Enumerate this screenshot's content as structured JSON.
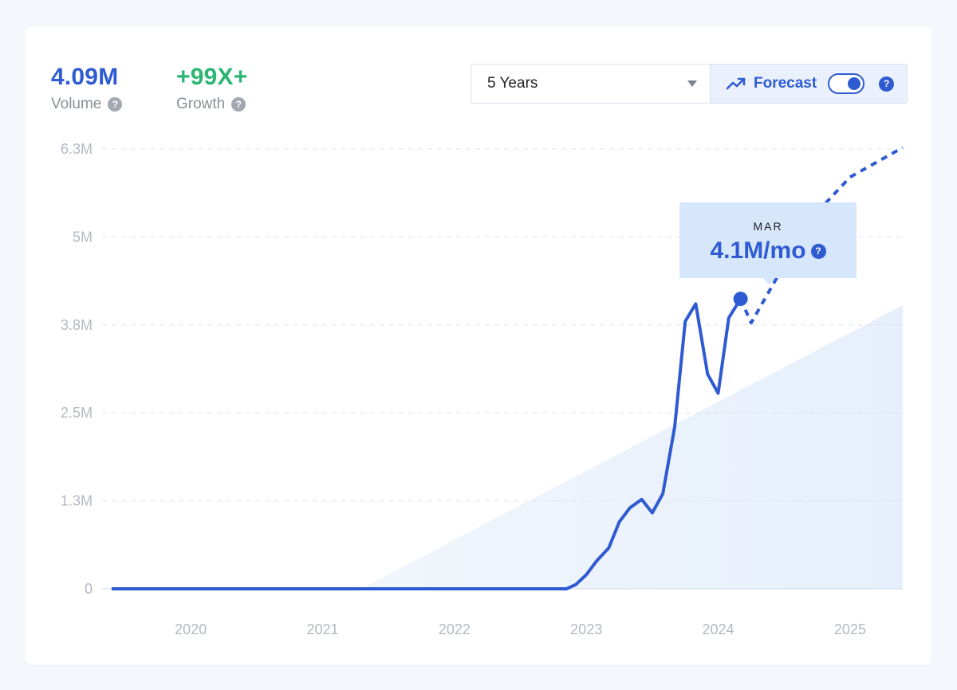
{
  "stats": {
    "volume": {
      "value": "4.09M",
      "label": "Volume",
      "color": "#2f5bd2"
    },
    "growth": {
      "value": "+99X+",
      "label": "Growth",
      "color": "#2bb673"
    }
  },
  "controls": {
    "range_selected": "5 Years",
    "forecast_label": "Forecast",
    "forecast_enabled": true,
    "icons": {
      "forecast": "trending-up-icon",
      "dropdown": "chevron-down-icon",
      "help": "help-icon"
    }
  },
  "tooltip": {
    "month": "MAR",
    "value": "4.1M/mo"
  },
  "chart_data": {
    "type": "line",
    "y_tick_labels": [
      "0",
      "1.3M",
      "2.5M",
      "3.8M",
      "5M",
      "6.3M"
    ],
    "y_ticks": [
      0,
      1250000,
      2500000,
      3750000,
      5000000,
      6250000
    ],
    "x_tick_labels": [
      "2020",
      "2021",
      "2022",
      "2023",
      "2024",
      "2025"
    ],
    "x_ticks": [
      2020.0,
      2021.0,
      2022.0,
      2023.0,
      2024.0,
      2025.0
    ],
    "xlim": [
      2019.4,
      2025.4
    ],
    "ylim": [
      0,
      6250000
    ],
    "grid": true,
    "series": [
      {
        "style": "solid",
        "color": "#2f5bd2",
        "points": [
          [
            2019.4,
            0
          ],
          [
            2022.85,
            0
          ],
          [
            2022.92,
            60000
          ],
          [
            2023.0,
            200000
          ],
          [
            2023.08,
            400000
          ],
          [
            2023.17,
            580000
          ],
          [
            2023.25,
            950000
          ],
          [
            2023.33,
            1150000
          ],
          [
            2023.42,
            1270000
          ],
          [
            2023.5,
            1080000
          ],
          [
            2023.58,
            1350000
          ],
          [
            2023.67,
            2300000
          ],
          [
            2023.75,
            3800000
          ],
          [
            2023.83,
            4050000
          ],
          [
            2023.92,
            3050000
          ],
          [
            2024.0,
            2780000
          ],
          [
            2024.08,
            3850000
          ],
          [
            2024.17,
            4120000
          ]
        ]
      },
      {
        "style": "dashed",
        "color": "#2f5bd2",
        "points": [
          [
            2024.17,
            4120000
          ],
          [
            2024.25,
            3780000
          ],
          [
            2024.5,
            4600000
          ],
          [
            2024.75,
            5350000
          ],
          [
            2025.0,
            5850000
          ],
          [
            2025.4,
            6270000
          ]
        ]
      }
    ],
    "trend_area": {
      "color": "#e6effb",
      "points": [
        [
          2021.29,
          0
        ],
        [
          2025.4,
          0
        ],
        [
          2025.4,
          4030000
        ]
      ]
    },
    "highlight": {
      "x": 2024.17,
      "y": 4120000
    }
  }
}
